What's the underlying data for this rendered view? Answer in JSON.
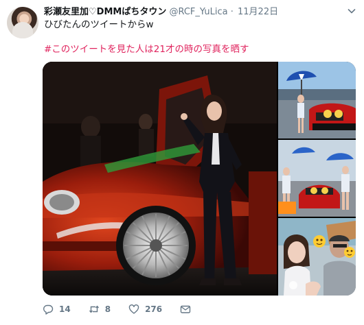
{
  "tweet": {
    "display_name": "彩瀬友里加♡DMMぱちタウン",
    "handle": "@RCF_YuLica",
    "separator": "·",
    "date": "11月22日",
    "line1": "ひびたんのツイートからw",
    "line2": "#このツイートを見た人は21才の時の写真を晒す"
  },
  "actions": {
    "reply_count": "14",
    "retweet_count": "8",
    "like_count": "276"
  },
  "colors": {
    "accent_pink": "#e0245e",
    "meta_gray": "#657786"
  },
  "icons": {
    "reply": "reply-icon",
    "retweet": "retweet-icon",
    "like": "heart-icon",
    "dm": "mail-icon",
    "more": "chevron-down-icon"
  }
}
